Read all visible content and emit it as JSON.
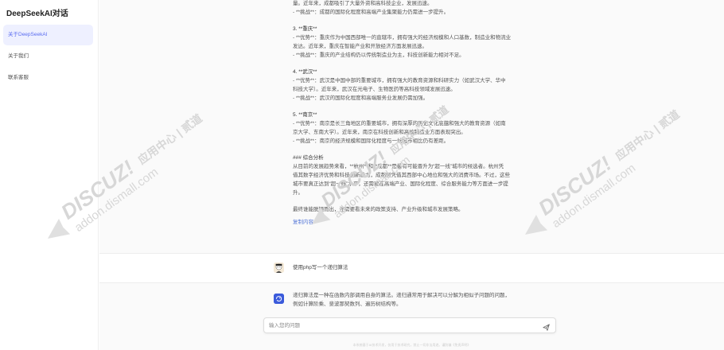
{
  "app": {
    "title": "DeepSeekAI对话"
  },
  "sidebar": {
    "items": [
      {
        "label": "关于DeepSeekAI",
        "active": true
      },
      {
        "label": "关于我们",
        "active": false
      },
      {
        "label": "联系客服",
        "active": false
      }
    ]
  },
  "answer": {
    "lines": [
      "量。近年来，成都吸引了大量外资和高科技企业，发展迅速。",
      "- **挑战**：成都的国际化程度和高端产业集聚能力仍需进一步提升。",
      "",
      "3. **重庆**",
      "- **优势**：重庆作为中国西部唯一的直辖市，拥有强大的经济规模和人口基数，制造业和物流业",
      "发达。近年来，重庆在智能产业和开放经济方面发展迅速。",
      "- **挑战**：重庆的产业结构仍以传统制造业为主，科技创新能力相对不足。",
      "",
      "4. **武汉**",
      "- **优势**：武汉是中国中部的重要城市，拥有强大的教育资源和科研实力（如武汉大学、华中",
      "科技大学）。近年来，武汉在光电子、生物医药等高科技领域发展迅速。",
      "- **挑战**：武汉的国际化程度和高端服务业发展仍需加强。",
      "",
      "5. **南京**",
      "- **优势**：南京是长三角地区的重要城市，拥有深厚的历史文化底蕴和强大的教育资源（如南",
      "京大学、东南大学）。近年来，南京在科技创新和高端制造业方面表现突出。",
      "- **挑战**：南京的经济规模和国际化程度与一线城市相比仍有差距。",
      "",
      "### 综合分析",
      "从目前的发展趋势来看，**杭州**和**成都**是最有可能晋升为“超一线”城市的候选者。杭州凭",
      "借其数字经济优势和科技创新能力，成都则凭借其西部中心地位和强大的消费市场。不过，这些",
      "城市要真正达到“超一线”水平，还需要在高端产业、国际化程度、综合服务能力等方面进一步提",
      "升。",
      "",
      "最终谁能脱颖而出，还需要看未来的政策支持、产业升级和城市发展策略。"
    ],
    "copy_label": "复制内容"
  },
  "user_message": {
    "text": "使用php写一个递归算法"
  },
  "bot_message": {
    "lines": [
      "递归算法是一种在函数内部调用自身的算法。递归通常用于解决可以分解为相似子问题的问题，",
      "例如计算阶乘、斐波那契数列、遍历树结构等。"
    ]
  },
  "input": {
    "placeholder": "输入您的问题",
    "value": ""
  },
  "footer": {
    "note": "本系统基于AI技术开发，仅用于技术研究，禁止一切非法用途。谨防骗《免责声明》"
  },
  "watermark": {
    "brand": "DISCUZ!",
    "line1": "应用中心 | 贰道",
    "line2": "addon.dismall.com"
  },
  "colors": {
    "accent": "#5a6cf0",
    "active_bg": "#eef0ff",
    "link": "#5a7bd8",
    "bot_icon": "#3b5bdb"
  },
  "icons": {
    "send": "send-icon",
    "bot": "deepseek-logo-icon",
    "user": "user-avatar"
  }
}
